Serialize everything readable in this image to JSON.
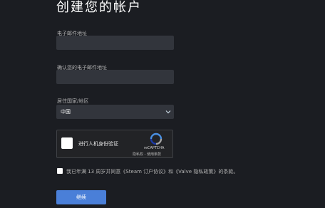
{
  "page": {
    "title": "创建您的帐户"
  },
  "form": {
    "email_label": "电子邮件地址",
    "email_value": "",
    "confirm_email_label": "确认您的电子邮件地址",
    "confirm_email_value": "",
    "country_label": "居住国家/地区",
    "country_value": "中国"
  },
  "captcha": {
    "text": "进行人机身份验证",
    "brand": "reCAPTCHA",
    "links": "隐私权 - 使用条款"
  },
  "agreement": {
    "text": "我已年满 13 周岁并同意《Steam 订户协议》和《Valve 隐私政策》的条款。"
  },
  "actions": {
    "continue_label": "继续"
  },
  "colors": {
    "background": "#1b1d22",
    "field": "#32353c",
    "accent": "#4a7fd8"
  }
}
